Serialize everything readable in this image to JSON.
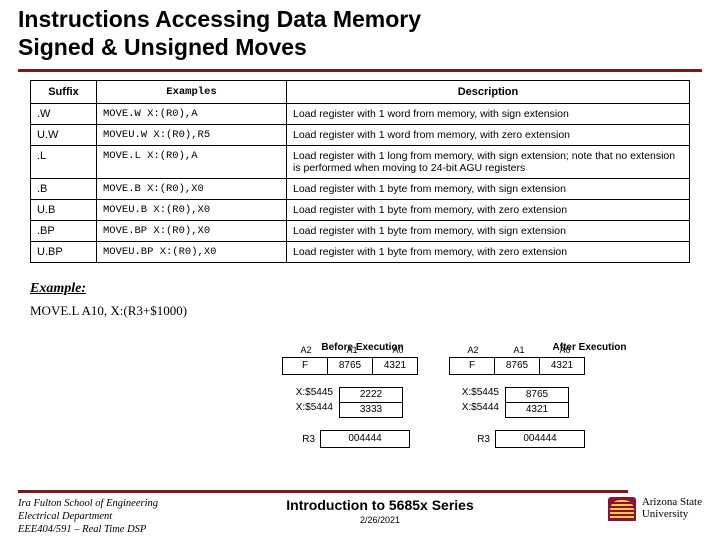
{
  "title": {
    "line1": "Instructions Accessing Data Memory",
    "line2": "Signed & Unsigned Moves"
  },
  "table": {
    "headers": {
      "suffix": "Suffix",
      "examples": "Examples",
      "description": "Description"
    },
    "rows": [
      {
        "suffix": ".W",
        "example": "MOVE.W X:(R0),A",
        "desc": "Load register with 1 word from memory, with sign extension"
      },
      {
        "suffix": "U.W",
        "example": "MOVEU.W X:(R0),R5",
        "desc": "Load register with 1 word from memory, with zero extension"
      },
      {
        "suffix": ".L",
        "example": "MOVE.L X:(R0),A",
        "desc": "Load register with 1 long from memory, with sign extension; note that no extension is performed when moving to 24-bit AGU registers"
      },
      {
        "suffix": ".B",
        "example": "MOVE.B X:(R0),X0",
        "desc": "Load register with 1 byte from memory, with sign extension"
      },
      {
        "suffix": "U.B",
        "example": "MOVEU.B X:(R0),X0",
        "desc": "Load register with 1 byte from memory, with zero extension"
      },
      {
        "suffix": ".BP",
        "example": "MOVE.BP X:(R0),X0",
        "desc": "Load register with 1 byte from memory, with sign extension"
      },
      {
        "suffix": "U.BP",
        "example": "MOVEU.BP X:(R0),X0",
        "desc": "Load register with 1 byte from memory, with zero extension"
      }
    ]
  },
  "example": {
    "label": "Example:",
    "code": "MOVE.L  A10, X:(R3+$1000)"
  },
  "exec": {
    "before_label": "Before Execution",
    "after_label": "After Execution",
    "acc_cols": {
      "c0": "F",
      "c1": "8765",
      "c2": "4321",
      "l0": "A2",
      "l1": "A1",
      "l2": "A0"
    },
    "before": {
      "acc": [
        "F",
        "8765",
        "4321"
      ],
      "mem": [
        [
          "X:$5445",
          "2222"
        ],
        [
          "X:$5444",
          "3333"
        ]
      ],
      "r3": "004444"
    },
    "after": {
      "acc": [
        "F",
        "8765",
        "4321"
      ],
      "mem": [
        [
          "X:$5445",
          "8765"
        ],
        [
          "X:$5444",
          "4321"
        ]
      ],
      "r3": "004444"
    },
    "r3_label": "R3"
  },
  "footer": {
    "left1": "Ira Fulton School of Engineering",
    "left2": "Electrical Department",
    "left3": "EEE404/591 – Real Time DSP",
    "series": "Introduction to 5685x Series",
    "date": "2/26/2021",
    "uni1": "Arizona State",
    "uni2": "University"
  }
}
